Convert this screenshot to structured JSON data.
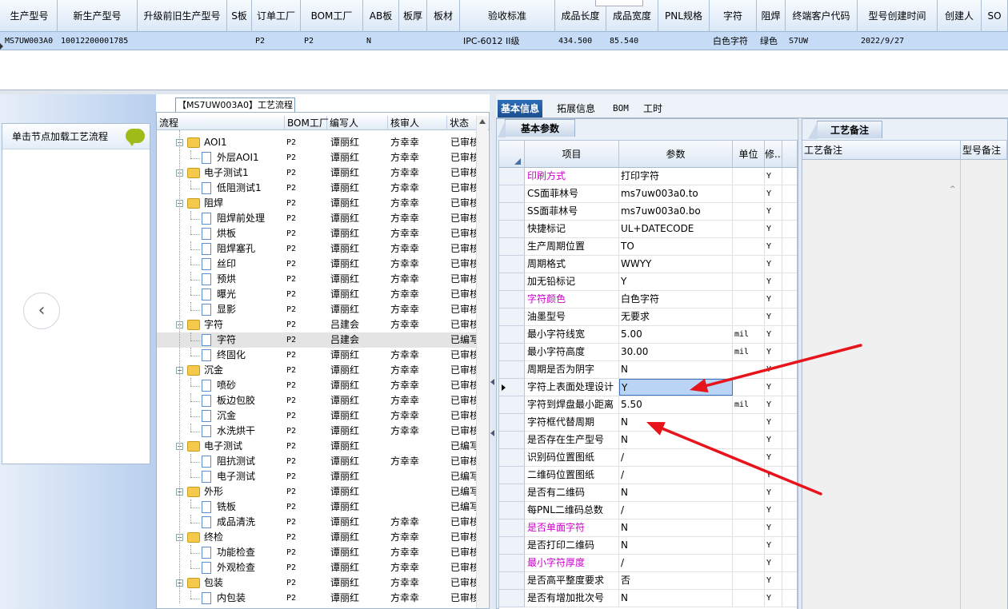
{
  "top_grid": {
    "columns": [
      "生产型号",
      "新生产型号",
      "升级前旧生产型号",
      "S板",
      "订单工厂",
      "BOM工厂",
      "AB板",
      "板厚",
      "板材",
      "验收标准",
      "成品长度",
      "成品宽度",
      "PNL规格",
      "字符",
      "阻焊",
      "终端客户代码",
      "型号创建时间",
      "创建人",
      "SO"
    ],
    "row": {
      "生产型号": "MS7UW003A0",
      "新生产型号": "10012200001785",
      "升级前旧生产型号": "",
      "S板": "",
      "订单工厂": "P2",
      "BOM工厂": "P2",
      "AB板": "N",
      "板厚": "",
      "板材": "",
      "验收标准": "IPC-6012 II级",
      "成品长度": "434.500",
      "成品宽度": "85.540",
      "PNL规格": "",
      "字符": "白色字符",
      "阻焊": "绿色",
      "终端客户代码": "S7UW",
      "型号创建时间": "2022/9/27",
      "创建人": "",
      "SO": ""
    }
  },
  "left_panel": {
    "load_label": "单击节点加载工艺流程",
    "back_icon": "chevron-left-icon"
  },
  "tree": {
    "title": "【MS7UW003A0】工艺流程",
    "columns": [
      "流程",
      "BOM工厂",
      "编写人",
      "核审人",
      "状态"
    ],
    "rows": [
      {
        "level": 0,
        "type": "folder",
        "name": "AOI1",
        "bom": "P2",
        "writer": "谭丽红",
        "reviewer": "方幸幸",
        "status": "已审核"
      },
      {
        "level": 1,
        "type": "doc",
        "name": "外层AOI1",
        "bom": "P2",
        "writer": "谭丽红",
        "reviewer": "方幸幸",
        "status": "已审核"
      },
      {
        "level": 0,
        "type": "folder",
        "name": "电子测试1",
        "bom": "P2",
        "writer": "谭丽红",
        "reviewer": "方幸幸",
        "status": "已审核"
      },
      {
        "level": 1,
        "type": "doc",
        "name": "低阻测试1",
        "bom": "P2",
        "writer": "谭丽红",
        "reviewer": "方幸幸",
        "status": "已审核"
      },
      {
        "level": 0,
        "type": "folder",
        "name": "阻焊",
        "bom": "P2",
        "writer": "谭丽红",
        "reviewer": "方幸幸",
        "status": "已审核"
      },
      {
        "level": 1,
        "type": "doc",
        "name": "阻焊前处理",
        "bom": "P2",
        "writer": "谭丽红",
        "reviewer": "方幸幸",
        "status": "已审核"
      },
      {
        "level": 1,
        "type": "doc",
        "name": "烘板",
        "bom": "P2",
        "writer": "谭丽红",
        "reviewer": "方幸幸",
        "status": "已审核"
      },
      {
        "level": 1,
        "type": "doc",
        "name": "阻焊塞孔",
        "bom": "P2",
        "writer": "谭丽红",
        "reviewer": "方幸幸",
        "status": "已审核"
      },
      {
        "level": 1,
        "type": "doc",
        "name": "丝印",
        "bom": "P2",
        "writer": "谭丽红",
        "reviewer": "方幸幸",
        "status": "已审核"
      },
      {
        "level": 1,
        "type": "doc",
        "name": "预烘",
        "bom": "P2",
        "writer": "谭丽红",
        "reviewer": "方幸幸",
        "status": "已审核"
      },
      {
        "level": 1,
        "type": "doc",
        "name": "曝光",
        "bom": "P2",
        "writer": "谭丽红",
        "reviewer": "方幸幸",
        "status": "已审核"
      },
      {
        "level": 1,
        "type": "doc",
        "name": "显影",
        "bom": "P2",
        "writer": "谭丽红",
        "reviewer": "方幸幸",
        "status": "已审核"
      },
      {
        "level": 0,
        "type": "folder",
        "name": "字符",
        "bom": "P2",
        "writer": "吕建会",
        "reviewer": "方幸幸",
        "status": "已审核"
      },
      {
        "level": 1,
        "type": "doc",
        "name": "字符",
        "bom": "P2",
        "writer": "吕建会",
        "reviewer": "",
        "status": "已编写",
        "selected": true
      },
      {
        "level": 1,
        "type": "doc",
        "name": "终固化",
        "bom": "P2",
        "writer": "谭丽红",
        "reviewer": "方幸幸",
        "status": "已审核"
      },
      {
        "level": 0,
        "type": "folder",
        "name": "沉金",
        "bom": "P2",
        "writer": "谭丽红",
        "reviewer": "方幸幸",
        "status": "已审核"
      },
      {
        "level": 1,
        "type": "doc",
        "name": "喷砂",
        "bom": "P2",
        "writer": "谭丽红",
        "reviewer": "方幸幸",
        "status": "已审核"
      },
      {
        "level": 1,
        "type": "doc",
        "name": "板边包胶",
        "bom": "P2",
        "writer": "谭丽红",
        "reviewer": "方幸幸",
        "status": "已审核"
      },
      {
        "level": 1,
        "type": "doc",
        "name": "沉金",
        "bom": "P2",
        "writer": "谭丽红",
        "reviewer": "方幸幸",
        "status": "已审核"
      },
      {
        "level": 1,
        "type": "doc",
        "name": "水洗烘干",
        "bom": "P2",
        "writer": "谭丽红",
        "reviewer": "方幸幸",
        "status": "已审核"
      },
      {
        "level": 0,
        "type": "folder",
        "name": "电子测试",
        "bom": "P2",
        "writer": "谭丽红",
        "reviewer": "",
        "status": "已编写"
      },
      {
        "level": 1,
        "type": "doc",
        "name": "阻抗测试",
        "bom": "P2",
        "writer": "谭丽红",
        "reviewer": "方幸幸",
        "status": "已审核"
      },
      {
        "level": 1,
        "type": "doc",
        "name": "电子测试",
        "bom": "P2",
        "writer": "谭丽红",
        "reviewer": "",
        "status": "已编写"
      },
      {
        "level": 0,
        "type": "folder",
        "name": "外形",
        "bom": "P2",
        "writer": "谭丽红",
        "reviewer": "",
        "status": "已编写"
      },
      {
        "level": 1,
        "type": "doc",
        "name": "铣板",
        "bom": "P2",
        "writer": "谭丽红",
        "reviewer": "",
        "status": "已编写"
      },
      {
        "level": 1,
        "type": "doc",
        "name": "成品清洗",
        "bom": "P2",
        "writer": "谭丽红",
        "reviewer": "方幸幸",
        "status": "已审核"
      },
      {
        "level": 0,
        "type": "folder",
        "name": "终检",
        "bom": "P2",
        "writer": "谭丽红",
        "reviewer": "方幸幸",
        "status": "已审核"
      },
      {
        "level": 1,
        "type": "doc",
        "name": "功能检查",
        "bom": "P2",
        "writer": "谭丽红",
        "reviewer": "方幸幸",
        "status": "已审核"
      },
      {
        "level": 1,
        "type": "doc",
        "name": "外观检查",
        "bom": "P2",
        "writer": "谭丽红",
        "reviewer": "方幸幸",
        "status": "已审核"
      },
      {
        "level": 0,
        "type": "folder",
        "name": "包装",
        "bom": "P2",
        "writer": "谭丽红",
        "reviewer": "方幸幸",
        "status": "已审核"
      },
      {
        "level": 1,
        "type": "doc",
        "name": "内包装",
        "bom": "P2",
        "writer": "谭丽红",
        "reviewer": "方幸幸",
        "status": "已审核"
      }
    ]
  },
  "tabs": [
    "基本信息",
    "拓展信息",
    "BOM",
    "工时"
  ],
  "params": {
    "title": "基本参数",
    "columns": [
      "项目",
      "参数",
      "单位",
      "修..."
    ],
    "rows": [
      {
        "item": "印刷方式",
        "value": "打印字符",
        "unit": "",
        "mod": "Y",
        "pink": true
      },
      {
        "item": "CS面菲林号",
        "value": "ms7uw003a0.to",
        "unit": "",
        "mod": "Y"
      },
      {
        "item": "SS面菲林号",
        "value": "ms7uw003a0.bo",
        "unit": "",
        "mod": "Y"
      },
      {
        "item": "快捷标记",
        "value": "UL+DATECODE",
        "unit": "",
        "mod": "Y"
      },
      {
        "item": "生产周期位置",
        "value": "TO",
        "unit": "",
        "mod": "Y"
      },
      {
        "item": "周期格式",
        "value": "WWYY",
        "unit": "",
        "mod": "Y"
      },
      {
        "item": "加无铅标记",
        "value": "Y",
        "unit": "",
        "mod": "Y"
      },
      {
        "item": "字符颜色",
        "value": "白色字符",
        "unit": "",
        "mod": "Y",
        "pink": true
      },
      {
        "item": "油墨型号",
        "value": "无要求",
        "unit": "",
        "mod": "Y"
      },
      {
        "item": "最小字符线宽",
        "value": "5.00",
        "unit": "mil",
        "mod": "Y"
      },
      {
        "item": "最小字符高度",
        "value": "30.00",
        "unit": "mil",
        "mod": "Y"
      },
      {
        "item": "周期是否为阴字",
        "value": "N",
        "unit": "",
        "mod": "Y"
      },
      {
        "item": "字符上表面处理设计",
        "value": "Y",
        "unit": "",
        "mod": "Y",
        "current": true
      },
      {
        "item": "字符到焊盘最小距离",
        "value": "5.50",
        "unit": "mil",
        "mod": "Y"
      },
      {
        "item": "字符框代替周期",
        "value": "N",
        "unit": "",
        "mod": "Y"
      },
      {
        "item": "是否存在生产型号",
        "value": "N",
        "unit": "",
        "mod": "Y"
      },
      {
        "item": "识别码位置图纸",
        "value": "/",
        "unit": "",
        "mod": "Y"
      },
      {
        "item": "二维码位置图纸",
        "value": "/",
        "unit": "",
        "mod": "Y"
      },
      {
        "item": "是否有二维码",
        "value": "N",
        "unit": "",
        "mod": "Y"
      },
      {
        "item": "每PNL二维码总数",
        "value": "/",
        "unit": "",
        "mod": "Y"
      },
      {
        "item": "是否单面字符",
        "value": "N",
        "unit": "",
        "mod": "Y",
        "pink": true
      },
      {
        "item": "是否打印二维码",
        "value": "N",
        "unit": "",
        "mod": "Y"
      },
      {
        "item": "最小字符厚度",
        "value": "/",
        "unit": "",
        "mod": "Y",
        "pink": true
      },
      {
        "item": "是否高平整度要求",
        "value": "否",
        "unit": "",
        "mod": "Y"
      },
      {
        "item": "是否有增加批次号",
        "value": "N",
        "unit": "",
        "mod": "Y"
      }
    ]
  },
  "notes": {
    "title": "工艺备注",
    "columns": [
      "工艺备注",
      "型号备注"
    ]
  },
  "colors": {
    "annotation_arrow": "#e8141c",
    "pink_label": "#cc00cc",
    "selection": "#c6dcf6"
  }
}
